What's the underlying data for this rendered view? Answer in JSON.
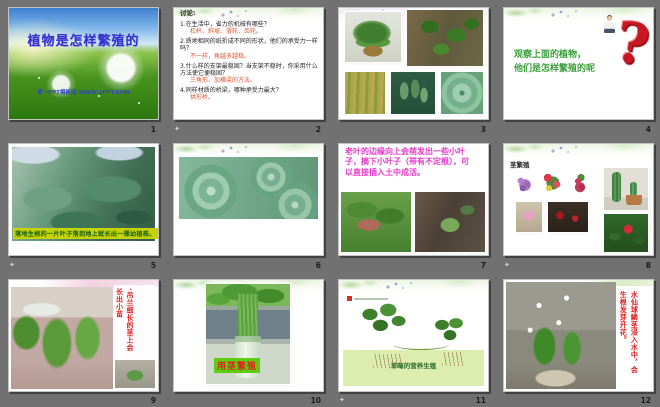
{
  "app": {
    "view": "slide-sorter",
    "canvas_bg": "#717171",
    "accent_colors": {
      "title_blue": "#3431cf",
      "answer_red": "#e0552e",
      "green_text": "#3a9e3a",
      "magenta_text": "#e53ac8",
      "vertical_red": "#e02020",
      "yellow_caption_bg": "#c6d300",
      "green_caption_bg": "#5ecc10",
      "question_mark_red": "#c81622"
    }
  },
  "icons": {
    "transition_glyph": "✦"
  },
  "slides": [
    {
      "number": "1",
      "title": "植物是怎样繁殖的",
      "subtitle": "第一PPT模板网-WWW.1PPT.COM"
    },
    {
      "number": "2",
      "heading": "讨论:",
      "q1": "1.在生活中，省力的机械有哪些？",
      "a1": "杠杆、斜坡、滑轮、齿轮。",
      "q2": "2.质地相同的纸折成不同的形状，他们的承受力一样吗？",
      "a2": "不一样，角越多越稳。",
      "q3": "3.什么样的支架最稳固？当支架不稳时，你采用什么方法使它便稳固？",
      "a3": "三角形、加横梁的方法。",
      "q4": "4.同样材质的桥梁，哪种承受力最大？",
      "a4": "拱形桥。"
    },
    {
      "number": "3"
    },
    {
      "number": "4",
      "line1": "观察上面的植物，",
      "line2": "他们是怎样繁殖的呢",
      "qmark": "?"
    },
    {
      "number": "5",
      "caption": "落地生根的一片叶子落到地上就长出一棵幼植株。"
    },
    {
      "number": "6"
    },
    {
      "number": "7",
      "text": "老叶的边缘向上会萌发出一些小叶子，摘下小叶子（带有不定根），可以直接插入土中成活。"
    },
    {
      "number": "8",
      "title": "茎繁殖"
    },
    {
      "number": "9",
      "vtext": "·吊兰细长的茎上会长出小苗"
    },
    {
      "number": "10",
      "caption": "用茎繁殖"
    },
    {
      "number": "11",
      "caption": "草莓的营养生殖"
    },
    {
      "number": "12",
      "vtext": "水仙球鳞茎浸入水中，会生根发芽开花。"
    }
  ]
}
